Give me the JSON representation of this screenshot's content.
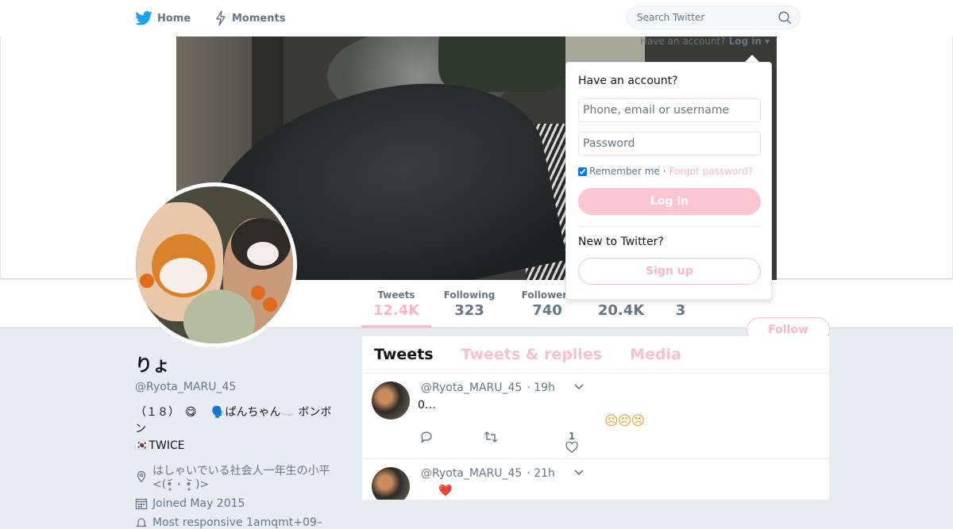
{
  "nav": {
    "home": "Home",
    "moments": "Moments",
    "search_placeholder": "Search Twitter"
  },
  "login_bar": {
    "prompt": "Have an account?",
    "link": "Log in"
  },
  "login_dropdown": {
    "title": "Have an account?",
    "username_placeholder": "Phone, email or username",
    "password_placeholder": "Password",
    "remember": "Remember me",
    "separator": "·",
    "forgot": "Forgot password?",
    "login_button": "Log in",
    "new_to": "New to Twitter?",
    "signup_button": "Sign up"
  },
  "stats": {
    "tweets": {
      "label": "Tweets",
      "value": "12.4K"
    },
    "following": {
      "label": "Following",
      "value": "323"
    },
    "followers": {
      "label": "Followers",
      "value": "740"
    },
    "likes": {
      "value": "20.4K"
    },
    "lists": {
      "value": "3"
    }
  },
  "follow_button": "Follow",
  "profile": {
    "name": "りょ",
    "handle": "@Ryota_MARU_45",
    "bio_line1": "（１８）　😋　 🗣️ぱんちゃん☁️ ボンボン",
    "bio_line2": "🇰🇷TWICE",
    "location": "はしゃいでいる社会人一年生の小平<(•̥̥̥᷄ ˔ •̥̥̥᷅ )>",
    "joined": "Joined May 2015",
    "responsive": "Most responsive 1amqmt+09–"
  },
  "timeline": {
    "tabs": [
      "Tweets",
      "Tweets & replies",
      "Media"
    ],
    "tweets": [
      {
        "handle": "@Ryota_MARU_45",
        "time": "· 19h",
        "text": "0…",
        "emoji": "😣😣😣",
        "likes": "1"
      },
      {
        "handle": "@Ryota_MARU_45",
        "time": "· 21h",
        "text": "❤️"
      }
    ]
  },
  "colors": {
    "accent": "#f9b6c3",
    "muted": "#657786",
    "bg": "#e6ecf0"
  }
}
